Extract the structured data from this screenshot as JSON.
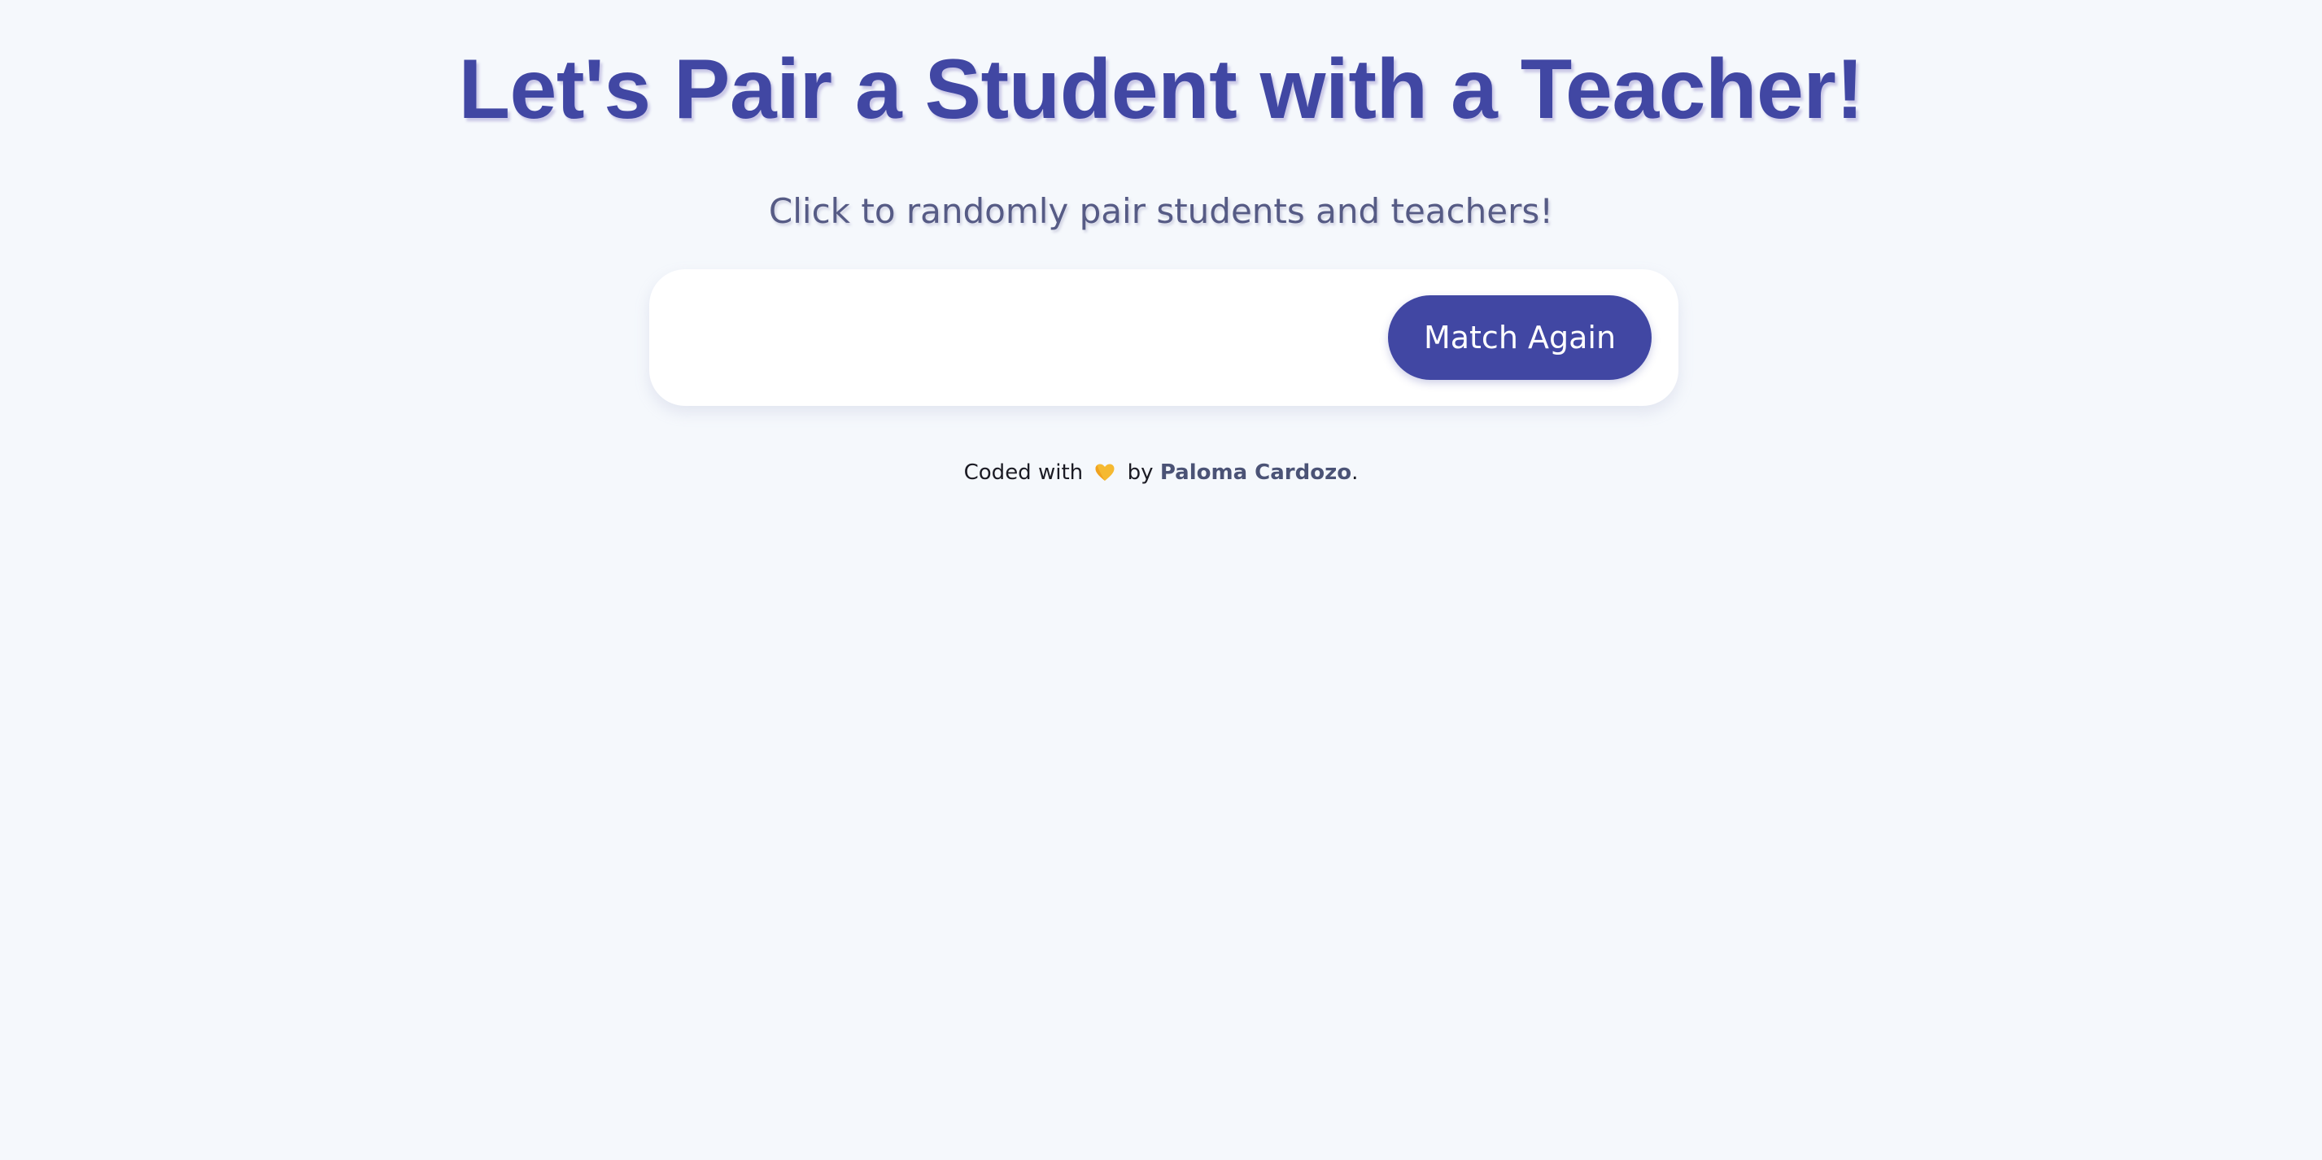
{
  "header": {
    "title": "Let's Pair a Student with a Teacher!",
    "subtitle": "Click to randomly pair students and teachers!"
  },
  "match_card": {
    "button_label": "Match Again"
  },
  "footer": {
    "prefix": "Coded with",
    "heart_icon": "yellow-heart-icon",
    "by": "by",
    "author": "Paloma Cardozo",
    "suffix": "."
  },
  "colors": {
    "background": "#f5f8fc",
    "accent": "#4147a3",
    "subtitle": "#565b85",
    "author_link": "#4b5376",
    "heart": "#f5b931"
  }
}
